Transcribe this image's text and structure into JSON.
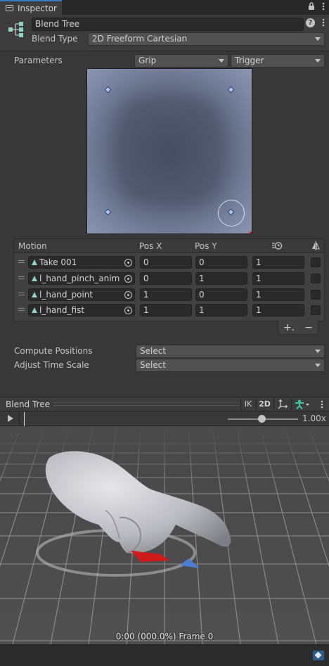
{
  "tab": {
    "title": "Inspector"
  },
  "header": {
    "name": "Blend Tree",
    "blend_type_label": "Blend Type",
    "blend_type_value": "2D Freeform Cartesian"
  },
  "parameters": {
    "label": "Parameters",
    "param_x": "Grip",
    "param_y": "Trigger"
  },
  "motion_table": {
    "headers": {
      "motion": "Motion",
      "pos_x": "Pos X",
      "pos_y": "Pos Y"
    },
    "rows": [
      {
        "name": "Take 001",
        "pos_x": "0",
        "pos_y": "0",
        "speed": "1"
      },
      {
        "name": "l_hand_pinch_anim",
        "pos_x": "0",
        "pos_y": "1",
        "speed": "1"
      },
      {
        "name": "l_hand_point",
        "pos_x": "1",
        "pos_y": "0",
        "speed": "1"
      },
      {
        "name": "l_hand_fist",
        "pos_x": "1",
        "pos_y": "1",
        "speed": "1"
      }
    ],
    "add_label": "+.",
    "remove_label": "−"
  },
  "compute_positions": {
    "label": "Compute Positions",
    "value": "Select"
  },
  "adjust_time_scale": {
    "label": "Adjust Time Scale",
    "value": "Select"
  },
  "preview": {
    "title": "Blend Tree",
    "ik_label": "IK",
    "mode_label": "2D",
    "speed": "1.00x",
    "frame_label": "0:00 (000.0%) Frame 0"
  },
  "icons": {
    "tab": "inspector-icon",
    "lock": "lock-icon",
    "menu": "kebab-menu-icon",
    "help": "help-icon",
    "blend_tree": "blend-tree-icon",
    "speed_header": "clock-speed-icon",
    "mirror_header": "mirror-icon",
    "pivot": "pivot-icon",
    "avatar": "avatar-icon",
    "tag": "tag-icon",
    "play": "play-icon"
  }
}
